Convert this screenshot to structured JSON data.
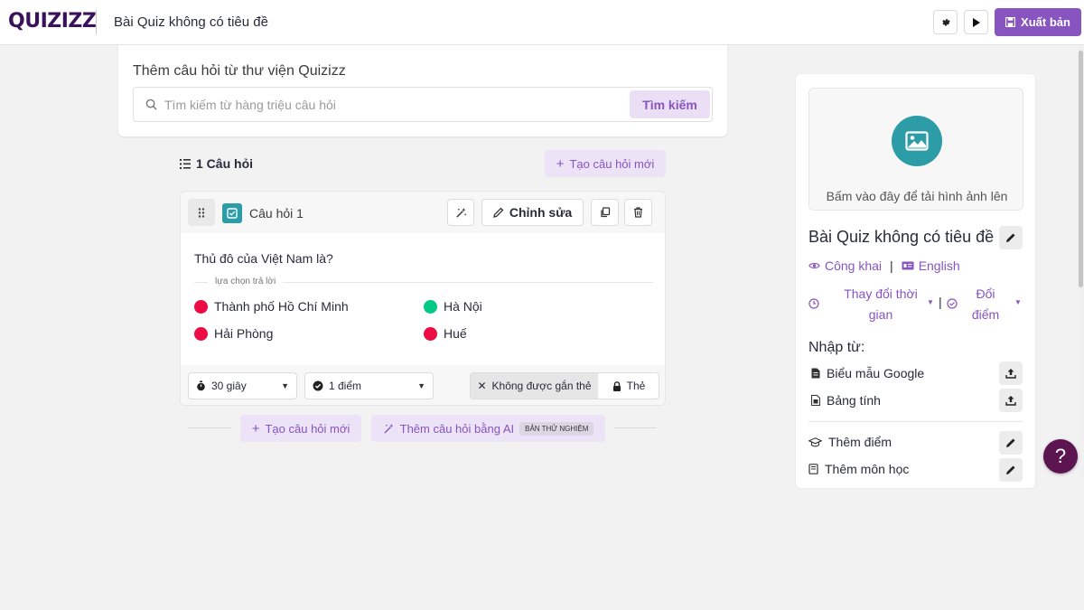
{
  "header": {
    "logo": "QUIZIZZ",
    "quiz_title": "Bài Quiz không có tiêu đề",
    "publish_label": "Xuất bản"
  },
  "library": {
    "title": "Thêm câu hỏi từ thư viện Quizizz",
    "search_placeholder": "Tìm kiếm từ hàng triệu câu hỏi",
    "search_button": "Tìm kiếm"
  },
  "questions": {
    "count_label": "1 Câu hỏi",
    "create_label": "Tạo câu hỏi mới"
  },
  "question_card": {
    "label": "Câu hỏi 1",
    "edit_label": "Chỉnh sửa",
    "text": "Thủ đô của Việt Nam là?",
    "answers_label": "lựa chọn trả lời",
    "answers": [
      {
        "text": "Thành phố Hồ Chí Minh",
        "correct": false
      },
      {
        "text": "Hà Nội",
        "correct": true
      },
      {
        "text": "Hải Phòng",
        "correct": false
      },
      {
        "text": "Huế",
        "correct": false
      }
    ],
    "time_value": "30 giây",
    "points_value": "1 điểm",
    "untagged_label": "Không được gắn thẻ",
    "tag_label": "Thẻ"
  },
  "bottom": {
    "create_label": "Tạo câu hỏi mới",
    "ai_label": "Thêm câu hỏi bằng AI",
    "beta_badge": "BẢN THỬ NGHIỆM"
  },
  "sidebar": {
    "upload_text": "Bấm vào đây để tải hình ảnh lên",
    "title": "Bài Quiz không có tiêu đề",
    "visibility": "Công khai",
    "language": "English",
    "time_line1": "Thay đổi thời",
    "time_line2": "gian",
    "points_line1": "Đổi",
    "points_line2": "điểm",
    "import_title": "Nhập từ:",
    "google_forms": "Biểu mẫu Google",
    "spreadsheet": "Bảng tính",
    "add_grade": "Thêm điểm",
    "add_subject": "Thêm môn học"
  },
  "help": "?",
  "colors": {
    "brand": "#8854c0",
    "correct": "#00c985",
    "incorrect": "#ec0b43",
    "teal": "#2c9ca6"
  }
}
